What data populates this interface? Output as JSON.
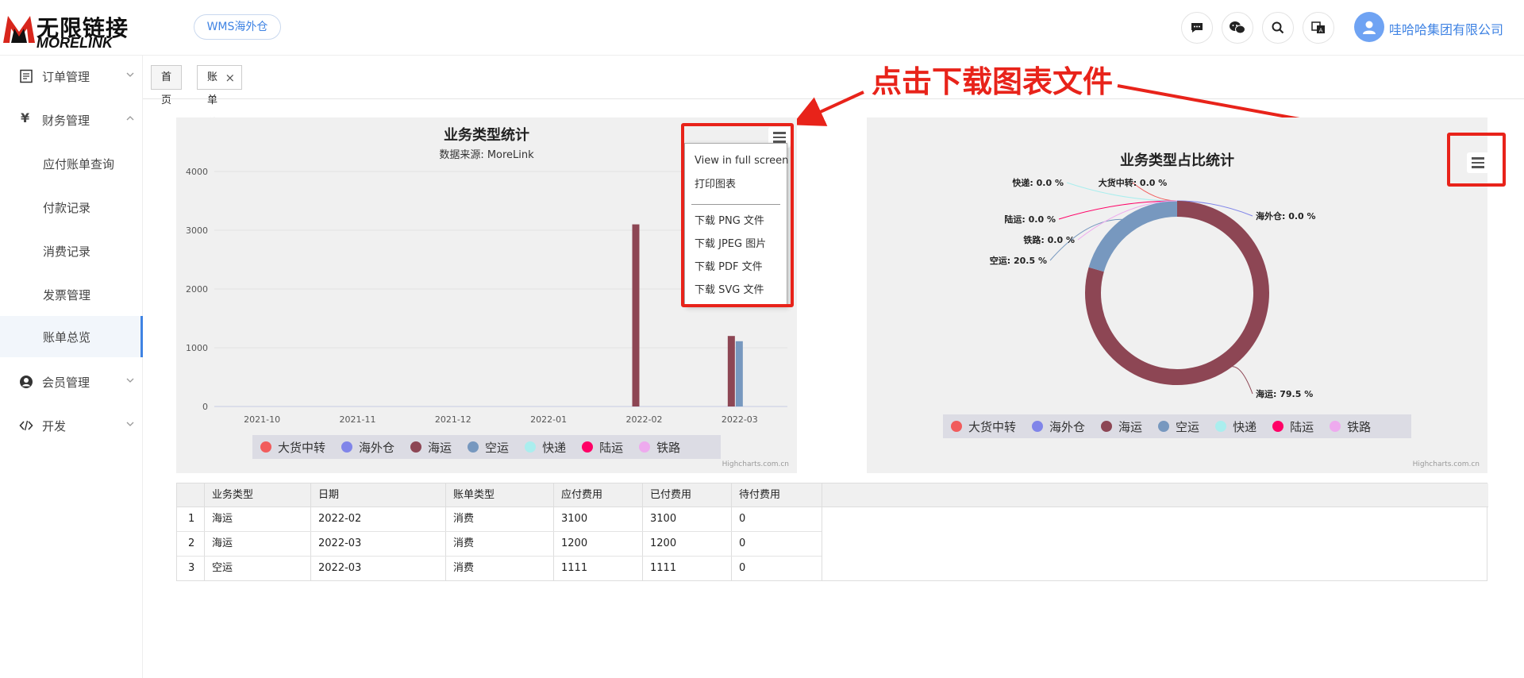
{
  "brand": {
    "name_cn": "无限链接",
    "name_en": "MORELINK"
  },
  "header": {
    "wms_button": "WMS海外仓",
    "icons": [
      "chat-icon",
      "wechat-icon",
      "search-icon",
      "translate-icon"
    ],
    "company": "哇哈哈集团有限公司"
  },
  "sidebar": {
    "order": "订单管理",
    "finance": "财务管理",
    "finance_symbol": "¥",
    "sub": [
      "应付账单查询",
      "付款记录",
      "消费记录",
      "发票管理",
      "账单总览"
    ],
    "member": "会员管理",
    "dev": "开发"
  },
  "tabs": {
    "home": "首页",
    "current": "账单总览",
    "close": "×"
  },
  "annotation": "点击下载图表文件",
  "bar_chart": {
    "title": "业务类型统计",
    "subtitle": "数据来源: MoreLink",
    "credit": "Highcharts.com.cn"
  },
  "menu": {
    "items": [
      "View in full screen",
      "打印图表",
      "下载 PNG 文件",
      "下载 JPEG 图片",
      "下载 PDF 文件",
      "下载 SVG 文件"
    ]
  },
  "pie_chart": {
    "title": "业务类型占比统计",
    "credit": "Highcharts.com.cn"
  },
  "chart_data": [
    {
      "type": "bar",
      "title": "业务类型统计",
      "subtitle": "数据来源: MoreLink",
      "categories": [
        "2021-10",
        "2021-11",
        "2021-12",
        "2022-01",
        "2022-02",
        "2022-03"
      ],
      "yticks": [
        0,
        1000,
        2000,
        3000,
        4000
      ],
      "ylim": [
        0,
        4000
      ],
      "legend_position": "bottom",
      "series": [
        {
          "name": "大货中转",
          "color": "#f15c5c",
          "values": [
            0,
            0,
            0,
            0,
            0,
            0
          ]
        },
        {
          "name": "海外仓",
          "color": "#8085e9",
          "values": [
            0,
            0,
            0,
            0,
            0,
            0
          ]
        },
        {
          "name": "海运",
          "color": "#8d4654",
          "values": [
            0,
            0,
            0,
            0,
            3100,
            1200
          ]
        },
        {
          "name": "空运",
          "color": "#7798bf",
          "values": [
            0,
            0,
            0,
            0,
            0,
            1111
          ]
        },
        {
          "name": "快递",
          "color": "#aaeeee",
          "values": [
            0,
            0,
            0,
            0,
            0,
            0
          ]
        },
        {
          "name": "陆运",
          "color": "#ff0066",
          "values": [
            0,
            0,
            0,
            0,
            0,
            0
          ]
        },
        {
          "name": "铁路",
          "color": "#eeaaee",
          "values": [
            0,
            0,
            0,
            0,
            0,
            0
          ]
        }
      ]
    },
    {
      "type": "pie",
      "title": "业务类型占比统计",
      "legend_position": "bottom",
      "slices": [
        {
          "name": "大货中转",
          "value": 0.0,
          "label": "大货中转: 0.0 %",
          "color": "#f15c5c"
        },
        {
          "name": "海外仓",
          "value": 0.0,
          "label": "海外仓: 0.0 %",
          "color": "#8085e9"
        },
        {
          "name": "海运",
          "value": 79.5,
          "label": "海运: 79.5 %",
          "color": "#8d4654"
        },
        {
          "name": "空运",
          "value": 20.5,
          "label": "空运: 20.5 %",
          "color": "#7798bf"
        },
        {
          "name": "快递",
          "value": 0.0,
          "label": "快递: 0.0 %",
          "color": "#aaeeee"
        },
        {
          "name": "陆运",
          "value": 0.0,
          "label": "陆运: 0.0 %",
          "color": "#ff0066"
        },
        {
          "name": "铁路",
          "value": 0.0,
          "label": "铁路: 0.0 %",
          "color": "#eeaaee"
        }
      ]
    }
  ],
  "table": {
    "headers": [
      "业务类型",
      "日期",
      "账单类型",
      "应付费用",
      "已付费用",
      "待付费用"
    ],
    "rows": [
      {
        "idx": "1",
        "cells": [
          "海运",
          "2022-02",
          "消费",
          "3100",
          "3100",
          "0"
        ]
      },
      {
        "idx": "2",
        "cells": [
          "海运",
          "2022-03",
          "消费",
          "1200",
          "1200",
          "0"
        ]
      },
      {
        "idx": "3",
        "cells": [
          "空运",
          "2022-03",
          "消费",
          "1111",
          "1111",
          "0"
        ]
      }
    ]
  }
}
